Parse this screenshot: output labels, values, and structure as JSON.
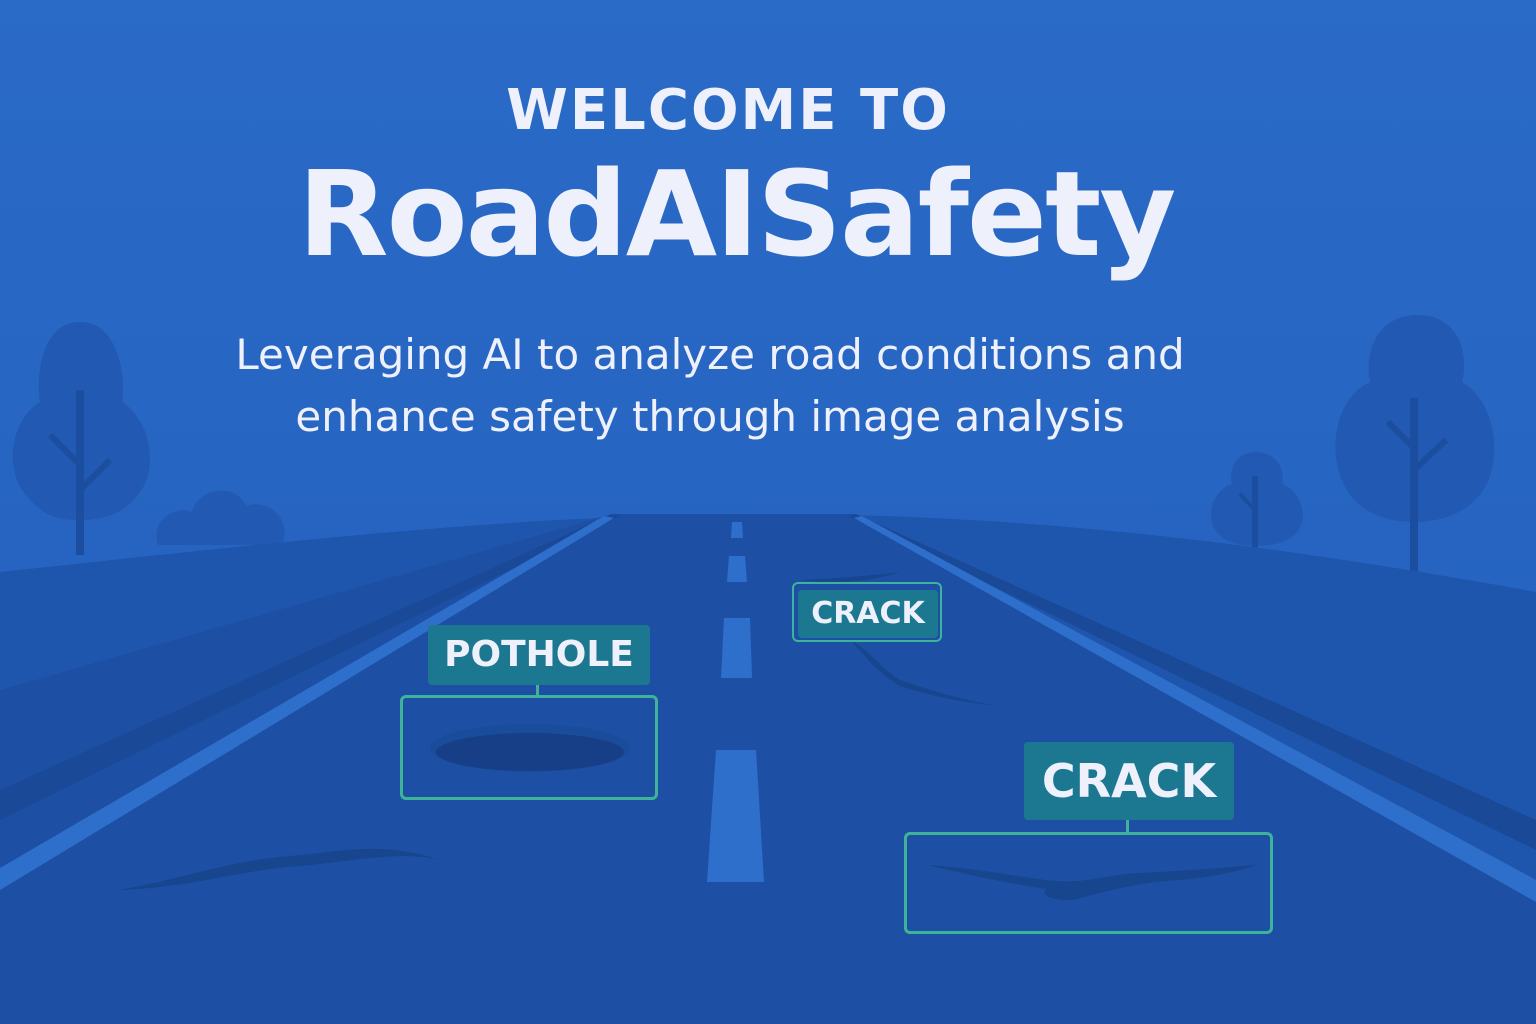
{
  "hero": {
    "eyebrow": "WELCOME TO",
    "title": "RoadAISafety",
    "subtitle": "Leveraging AI to analyze road conditions and enhance safety through image analysis"
  },
  "detections": [
    {
      "label": "POTHOLE",
      "type": "pothole"
    },
    {
      "label": "CRACK",
      "type": "crack"
    },
    {
      "label": "CRACK",
      "type": "crack"
    }
  ],
  "colors": {
    "sky": "#2767c4",
    "hill": "#1f56ad",
    "road": "#1d50a4",
    "lane_marking": "#2f6fcc",
    "label_fill": "#1c7890",
    "box_stroke": "#3fb39a",
    "text": "#eef0fb"
  },
  "icons": [
    "tree-icon",
    "bush-icon",
    "pothole-icon",
    "crack-icon"
  ]
}
